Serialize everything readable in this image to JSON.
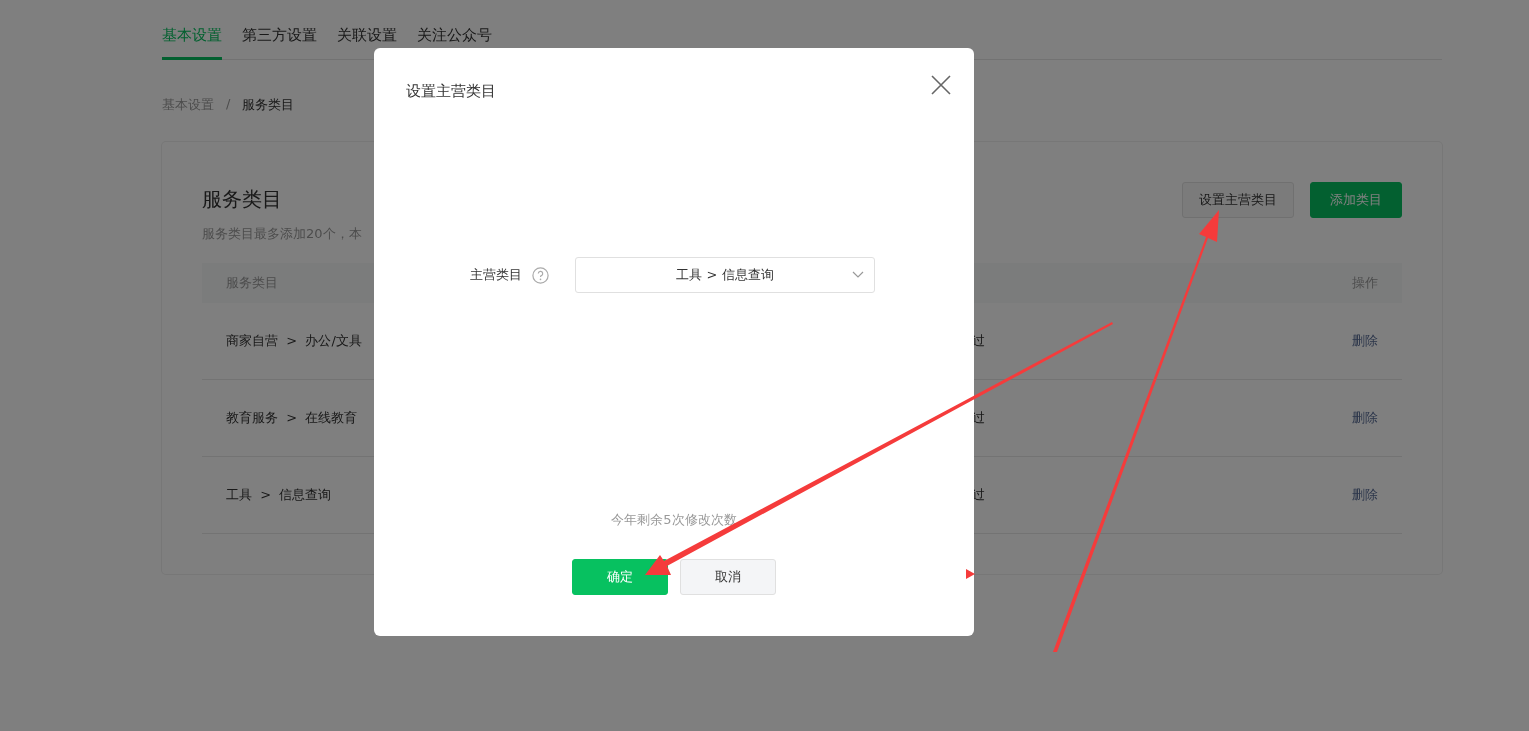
{
  "tabs": [
    {
      "label": "基本设置",
      "selected": true
    },
    {
      "label": "第三方设置",
      "selected": false
    },
    {
      "label": "关联设置",
      "selected": false
    },
    {
      "label": "关注公众号",
      "selected": false
    }
  ],
  "breadcrumb": {
    "separator": "/",
    "items": [
      "基本设置",
      "服务类目"
    ]
  },
  "card": {
    "title": "服务类目",
    "note": "服务类目最多添加20个，本",
    "buttons": [
      {
        "label": "设置主营类目",
        "kind": "secondary"
      },
      {
        "label": "添加类目",
        "kind": "primary"
      }
    ]
  },
  "table": {
    "header": {
      "category": "服务类目",
      "action": "操作"
    },
    "rows": [
      {
        "category": "商家自营  >  办公/文具",
        "status": "过",
        "action": "删除"
      },
      {
        "category": "教育服务  >  在线教育",
        "status": "过",
        "action": "删除"
      },
      {
        "category": "工具  >  信息查询",
        "status": "过",
        "action": "删除"
      }
    ]
  },
  "modal": {
    "title": "设置主营类目",
    "field": {
      "label": "主营类目",
      "value": "工具 > 信息查询"
    },
    "hint": "今年剩余5次修改次数",
    "buttons": [
      {
        "label": "确定",
        "kind": "primary"
      },
      {
        "label": "取消",
        "kind": "secondary"
      }
    ]
  }
}
